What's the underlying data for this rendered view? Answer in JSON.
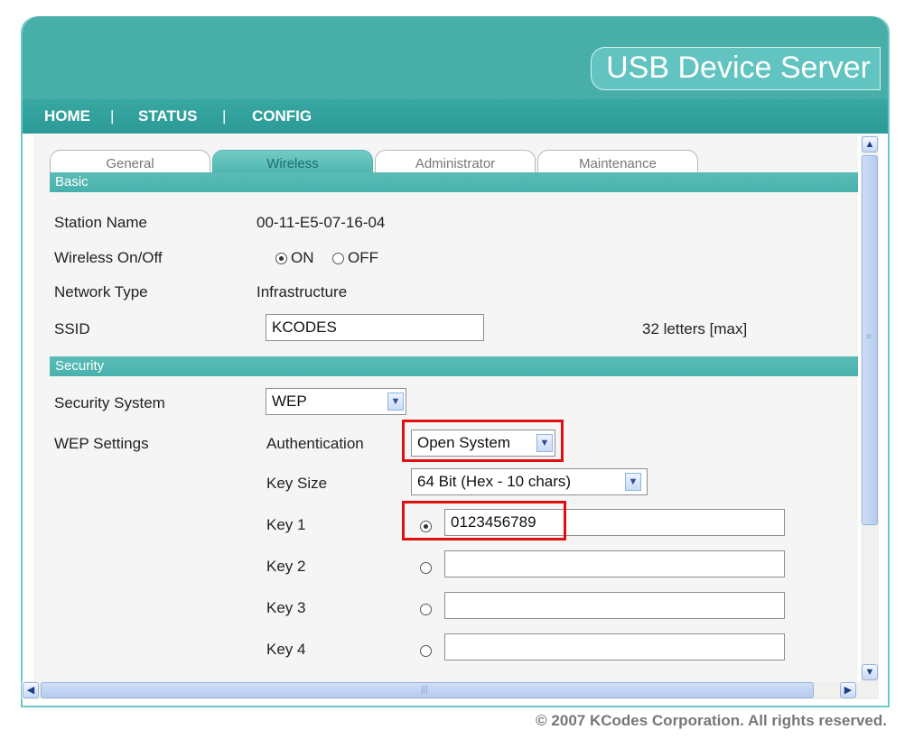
{
  "brand": "USB Device Server",
  "nav": {
    "home": "HOME",
    "sep1": "|",
    "status": "STATUS",
    "sep2": "|",
    "config": "CONFIG"
  },
  "tabs": [
    {
      "label": "General",
      "active": false
    },
    {
      "label": "Wireless",
      "active": true
    },
    {
      "label": "Administrator",
      "active": false
    },
    {
      "label": "Maintenance",
      "active": false
    }
  ],
  "basic": {
    "title": "Basic",
    "station_name_label": "Station Name",
    "station_name_value": "00-11-E5-07-16-04",
    "wireless_label": "Wireless On/Off",
    "on_label": "ON",
    "off_label": "OFF",
    "network_type_label": "Network Type",
    "network_type_value": "Infrastructure",
    "ssid_label": "SSID",
    "ssid_value": "KCODES",
    "ssid_hint": "32 letters [max]"
  },
  "security": {
    "title": "Security",
    "security_system_label": "Security System",
    "security_system_value": "WEP",
    "wep_settings_label": "WEP Settings",
    "authentication_label": "Authentication",
    "authentication_value": "Open System",
    "key_size_label": "Key Size",
    "key_size_value": "64 Bit (Hex - 10 chars)",
    "keys": [
      {
        "label": "Key 1",
        "value": "0123456789",
        "selected": true
      },
      {
        "label": "Key 2",
        "value": "",
        "selected": false
      },
      {
        "label": "Key 3",
        "value": "",
        "selected": false
      },
      {
        "label": "Key 4",
        "value": "",
        "selected": false
      }
    ]
  },
  "footer": "© 2007 KCodes Corporation. All rights reserved.",
  "colors": {
    "banner": "#47aea8",
    "nav": "#2c9a95",
    "section": "#48b1ac",
    "highlight": "#e01010"
  }
}
